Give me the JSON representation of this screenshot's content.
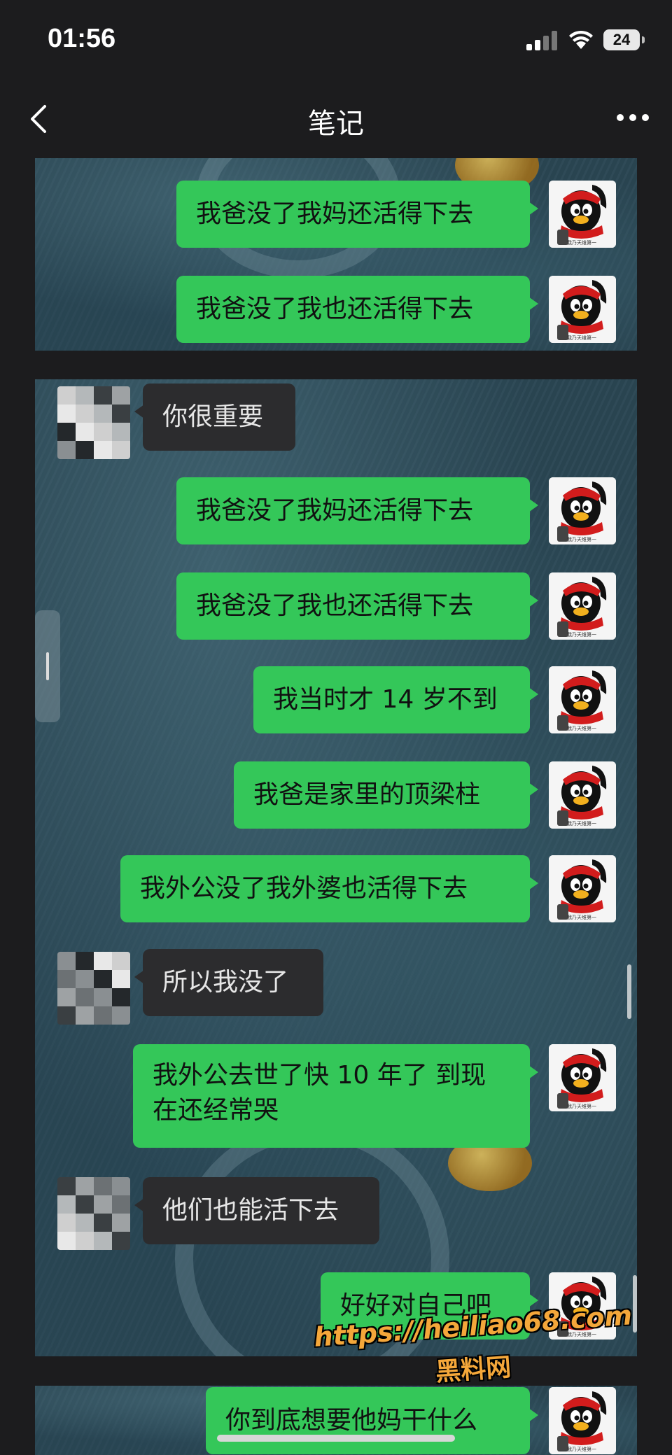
{
  "status_bar": {
    "time": "01:56",
    "battery": "24"
  },
  "nav": {
    "title": "笔记"
  },
  "panel1": {
    "messages": [
      {
        "side": "me",
        "text": "我爸没了我妈还活得下去"
      },
      {
        "side": "me",
        "text": "我爸没了我也还活得下去"
      }
    ]
  },
  "panel2": {
    "messages": [
      {
        "side": "them",
        "text": "你很重要"
      },
      {
        "side": "me",
        "text": "我爸没了我妈还活得下去"
      },
      {
        "side": "me",
        "text": "我爸没了我也还活得下去"
      },
      {
        "side": "me",
        "text": "我当时才 14 岁不到"
      },
      {
        "side": "me",
        "text": "我爸是家里的顶梁柱"
      },
      {
        "side": "me",
        "text": "我外公没了我外婆也活得下去"
      },
      {
        "side": "them",
        "text": "所以我没了"
      },
      {
        "side": "me",
        "text": "我外公去世了快 10 年了 到现在还经常哭"
      },
      {
        "side": "them",
        "text": "他们也能活下去"
      },
      {
        "side": "me",
        "text": "好好对自己吧"
      }
    ]
  },
  "panel3": {
    "messages": [
      {
        "side": "me",
        "text": "你到底想要他妈干什么"
      }
    ]
  },
  "avatar_caption": "我乃天维第一",
  "watermark": {
    "url": "https://heiliao68.com",
    "name": "黑料网"
  },
  "colors": {
    "me_bubble": "#34c759",
    "them_bubble": "#2c2c2e",
    "background": "#1c1c1e"
  }
}
